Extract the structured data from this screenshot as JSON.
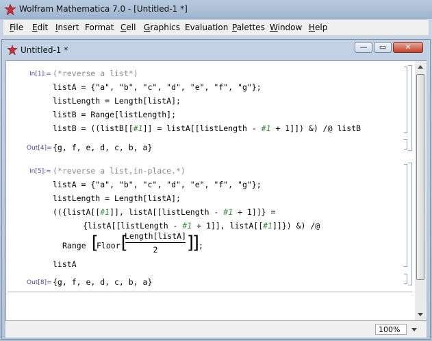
{
  "app": {
    "title": "Wolfram Mathematica 7.0 - [Untitled-1 *]",
    "logo_icon": "mathematica-star-icon"
  },
  "menu": [
    {
      "label": "File",
      "key": "F",
      "rest": "ile"
    },
    {
      "label": "Edit",
      "key": "E",
      "rest": "dit"
    },
    {
      "label": "Insert",
      "key": "I",
      "rest": "nsert"
    },
    {
      "label": "Format",
      "key": "",
      "rest": "Format"
    },
    {
      "label": "Cell",
      "key": "C",
      "rest": "ell"
    },
    {
      "label": "Graphics",
      "key": "G",
      "rest": "raphics"
    },
    {
      "label": "Evaluation",
      "key": "",
      "rest": "Evaluation"
    },
    {
      "label": "Palettes",
      "key": "P",
      "rest": "alettes"
    },
    {
      "label": "Window",
      "key": "W",
      "rest": "indow"
    },
    {
      "label": "Help",
      "key": "H",
      "rest": "elp"
    }
  ],
  "notebook": {
    "title": "Untitled-1 *",
    "controls": {
      "minimize": "—",
      "restore": "▭",
      "close": "✕"
    }
  },
  "cells": {
    "in1": {
      "label": "In[1]:=",
      "l1": "(*reverse a list*)",
      "l2": "listA = {\"a\", \"b\", \"c\", \"d\", \"e\", \"f\", \"g\"};",
      "l3": "listLength = Length[listA];",
      "l4": "listB = Range[listLength];",
      "l5a": "listB = ((listB[[",
      "l5b": "#1",
      "l5c": "]] = listA[[listLength - ",
      "l5d": "#1",
      "l5e": " + 1]]) &) /@ listB"
    },
    "out4": {
      "label": "Out[4]=",
      "text": "{g, f, e, d, c, b, a}"
    },
    "in5": {
      "label": "In[5]:=",
      "l1": "(*reverse a list,in-place.*)",
      "l2": "listA = {\"a\", \"b\", \"c\", \"d\", \"e\", \"f\", \"g\"};",
      "l3": "listLength = Length[listA];",
      "l4a": "(({listA[[",
      "l4b": "#1",
      "l4c": "]], listA[[listLength - ",
      "l4d": "#1",
      "l4e": " + 1]]} =",
      "l5a": "{listA[[listLength - ",
      "l5b": "#1",
      "l5c": " + 1]], listA[[",
      "l5d": "#1",
      "l5e": "]]}) &) /@",
      "l6a": "Range",
      "l6b": "Floor",
      "l6num": "Length[listA]",
      "l6den": "2",
      "l6end": ";",
      "l7": "listA"
    },
    "out8": {
      "label": "Out[8]=",
      "text": "{g, f, e, d, c, b, a}"
    }
  },
  "status": {
    "zoom": "100%"
  }
}
